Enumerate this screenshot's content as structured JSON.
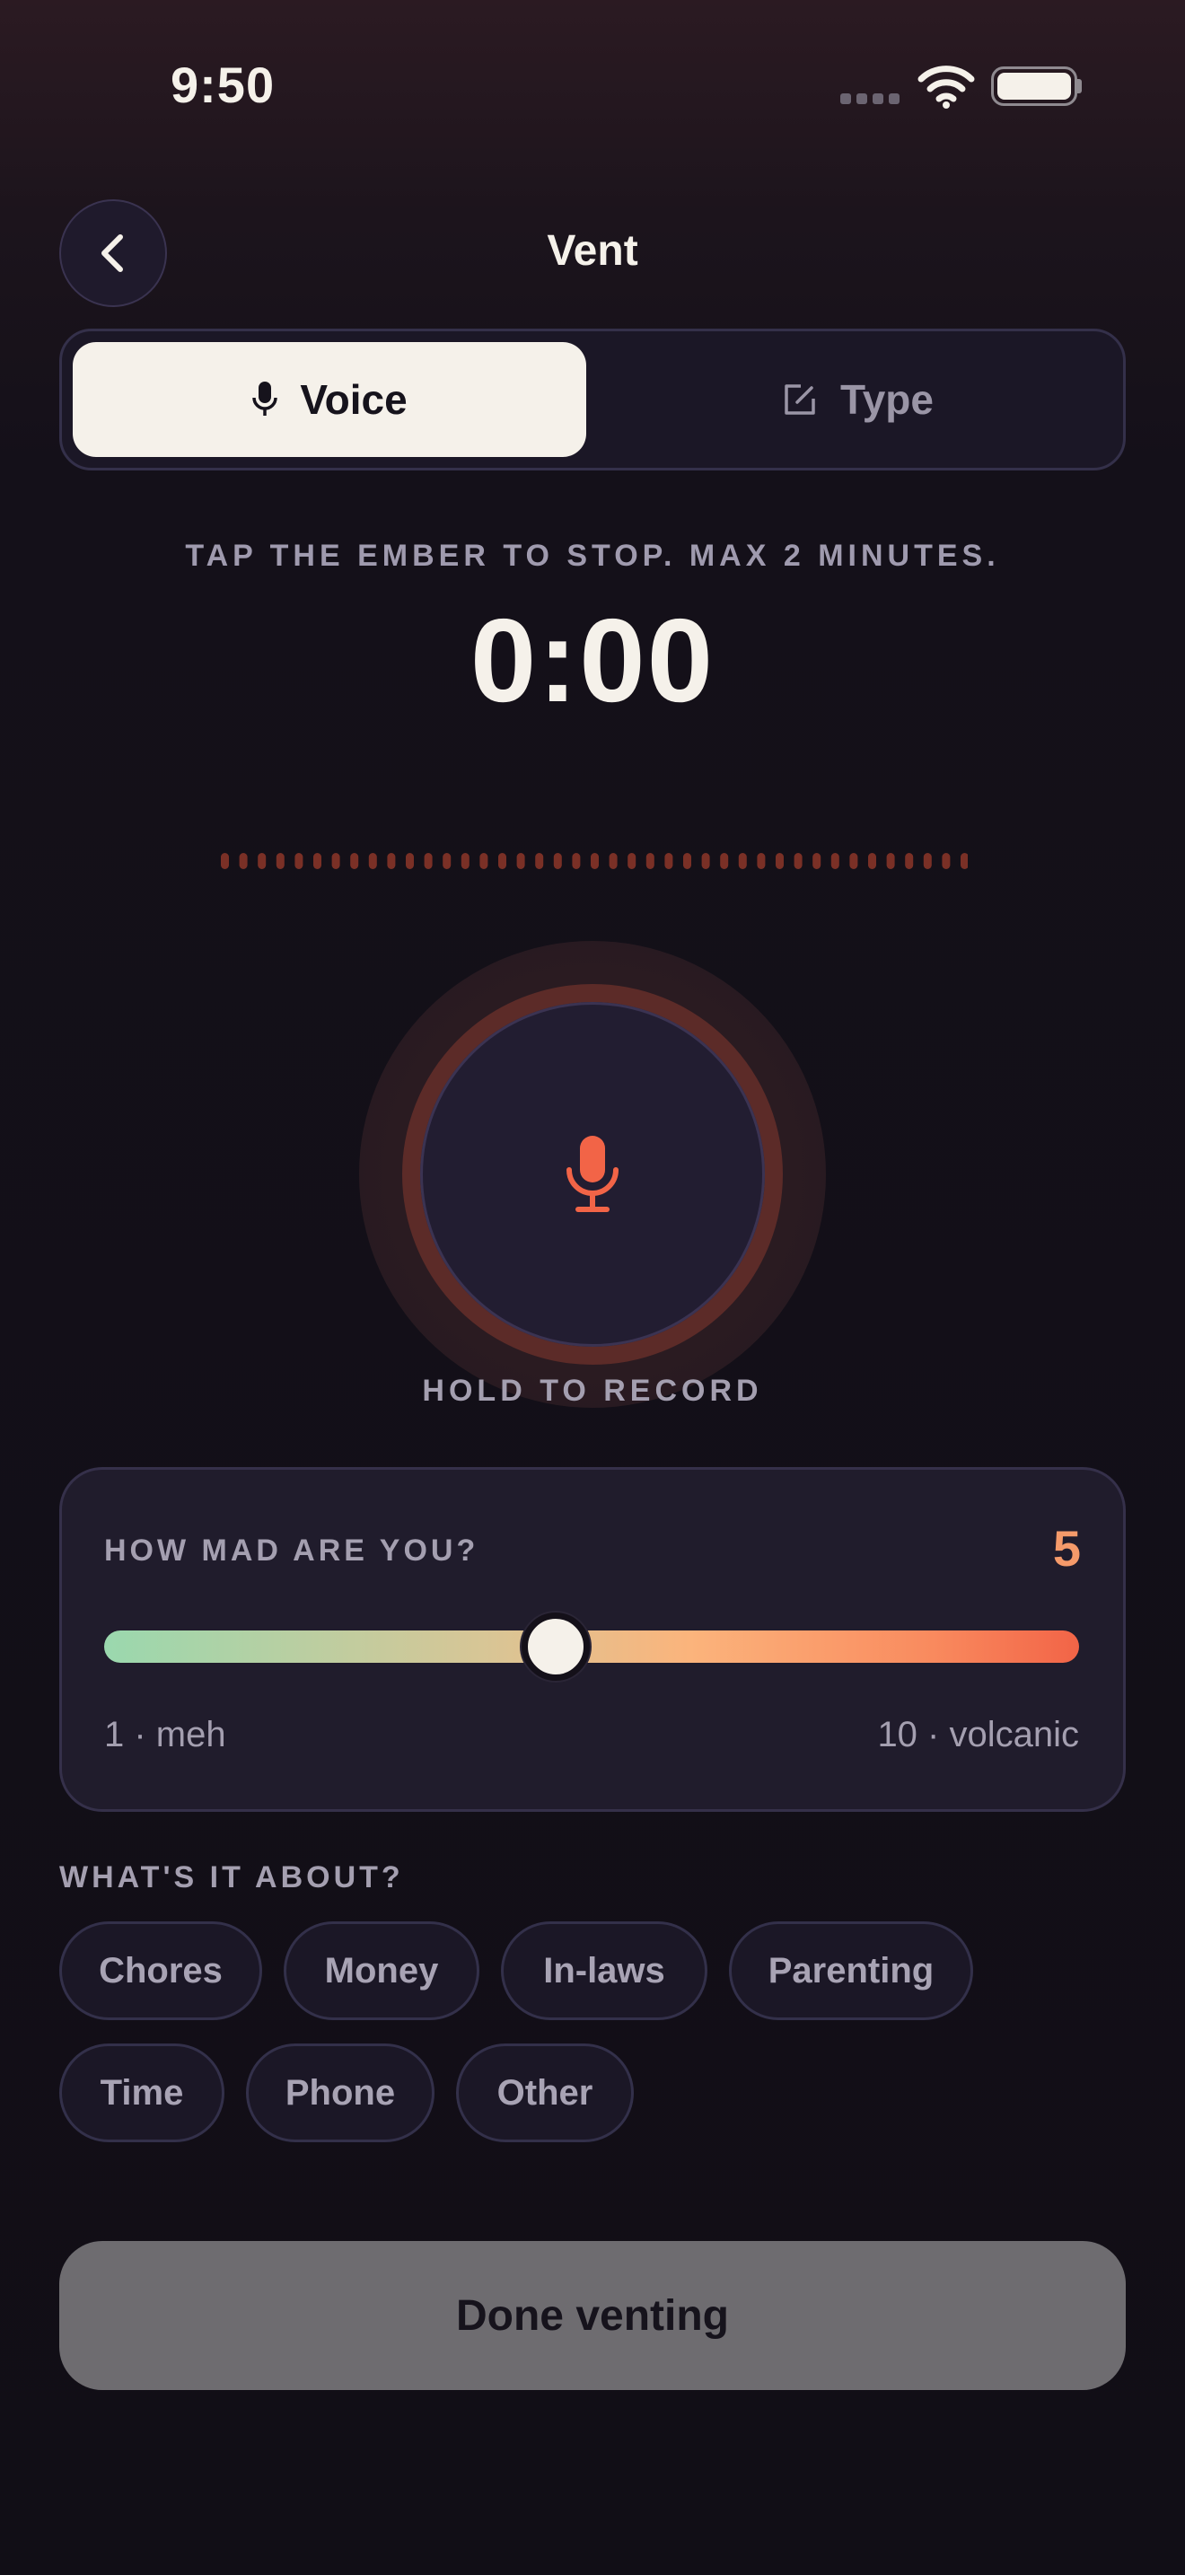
{
  "status_bar": {
    "time": "9:50"
  },
  "header": {
    "title": "Vent",
    "back_icon": "chevron-left-icon"
  },
  "mode_tabs": [
    {
      "label": "Voice",
      "icon": "mic-icon",
      "selected": true
    },
    {
      "label": "Type",
      "icon": "edit-icon",
      "selected": false
    }
  ],
  "recorder": {
    "hint": "TAP THE EMBER TO STOP. MAX 2 MINUTES.",
    "timer": "0:00",
    "hold_label": "HOLD TO RECORD",
    "button_icon": "mic-icon"
  },
  "mad_meter": {
    "label": "HOW MAD ARE YOU?",
    "value": "5",
    "min": 1,
    "max": 10,
    "min_label": "1 · meh",
    "max_label": "10 · volcanic"
  },
  "topics": {
    "label": "WHAT'S IT ABOUT?",
    "chips": [
      "Chores",
      "Money",
      "In-laws",
      "Parenting",
      "Time",
      "Phone",
      "Other"
    ]
  },
  "footer": {
    "done_label": "Done venting"
  },
  "colors": {
    "accent": "#F26447",
    "accent_soft": "#F59A6A",
    "calm": "#9AD8AE",
    "cream": "#F5F1EA",
    "background": "#110E16"
  }
}
